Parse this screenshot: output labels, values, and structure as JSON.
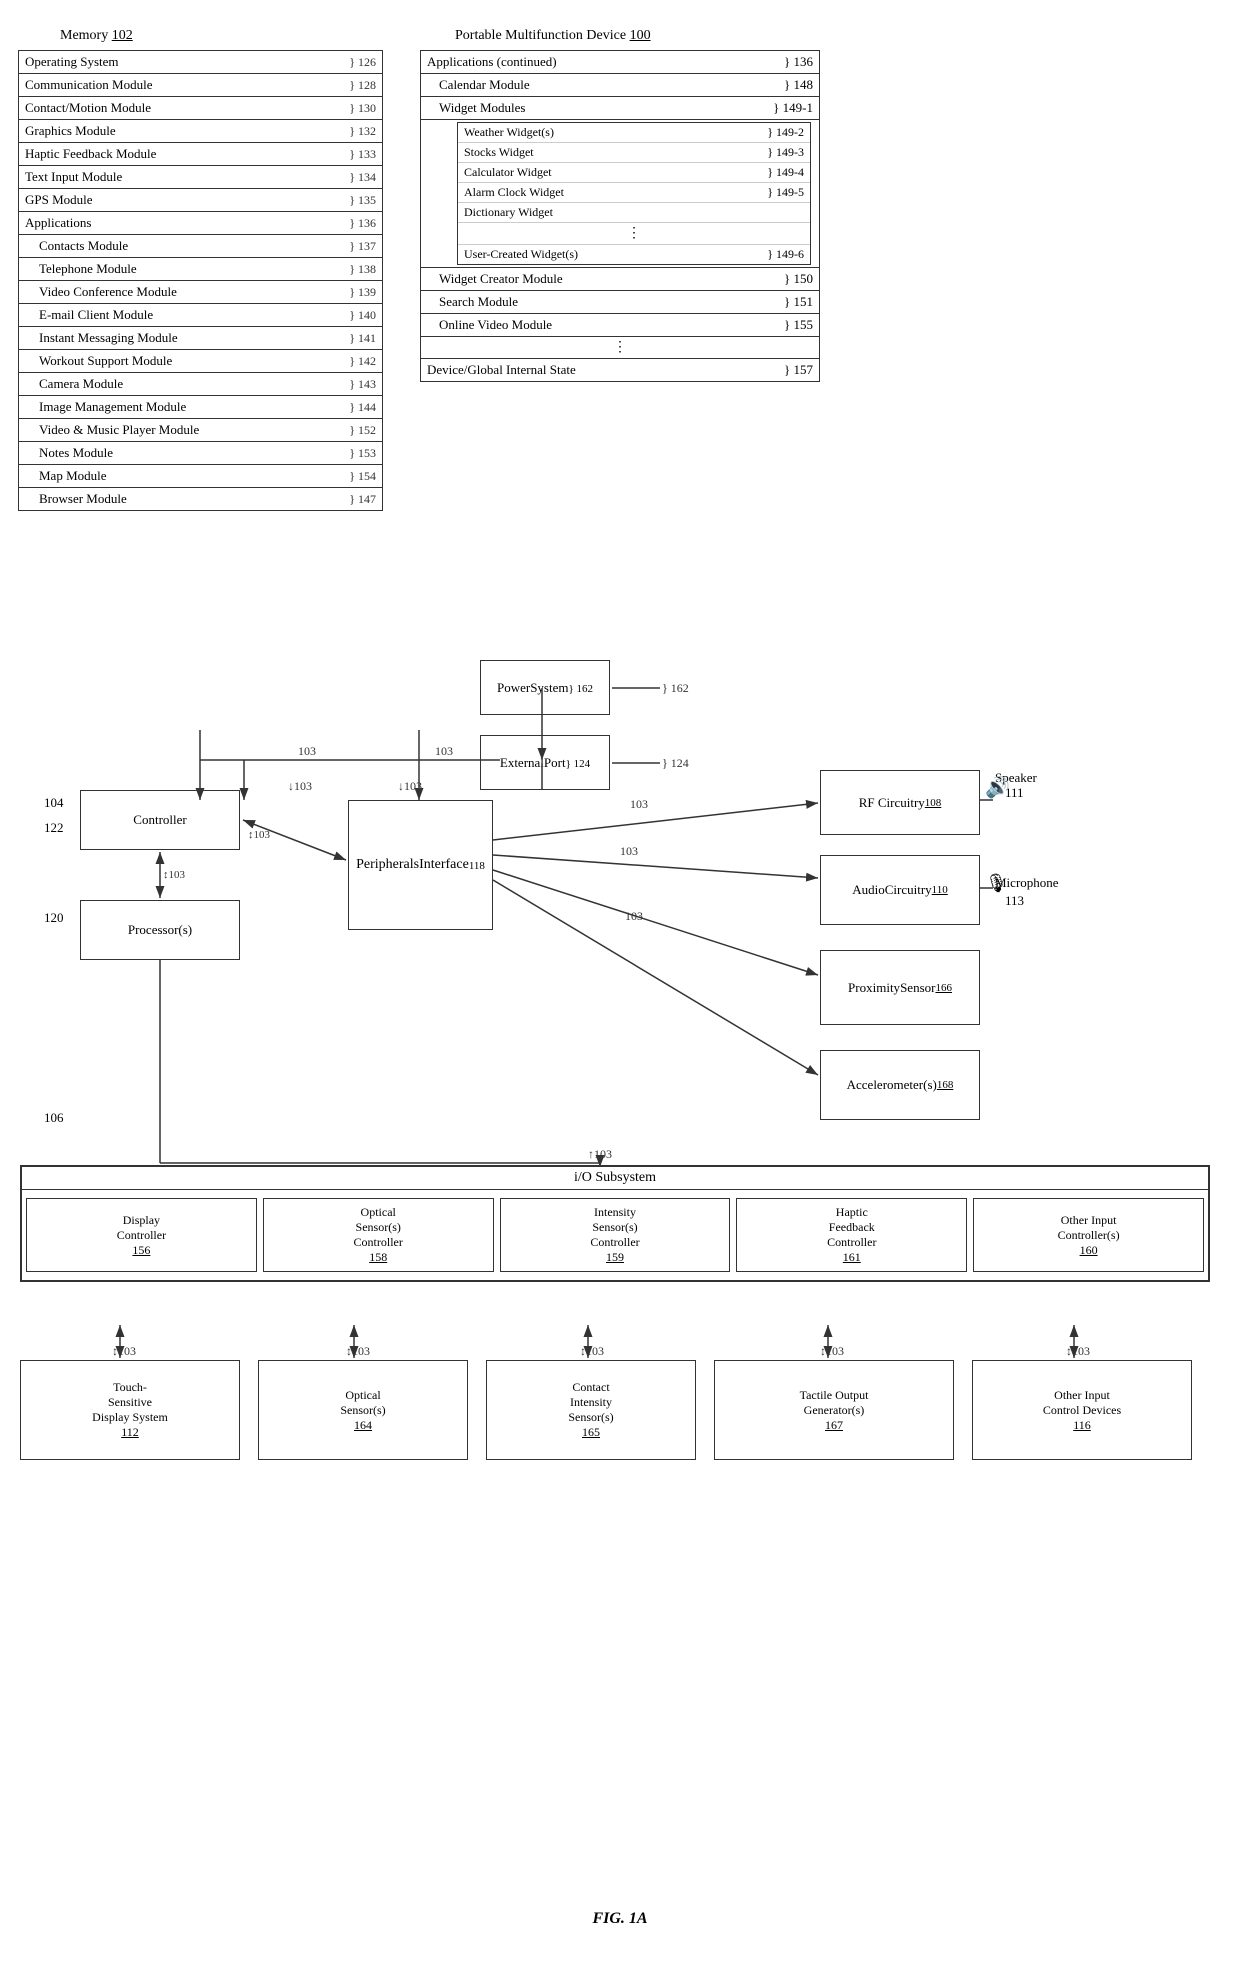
{
  "title": "FIG. 1A",
  "memory": {
    "label": "Memory",
    "ref": "102",
    "rows": [
      {
        "label": "Operating System",
        "ref": "126"
      },
      {
        "label": "Communication Module",
        "ref": "128"
      },
      {
        "label": "Contact/Motion Module",
        "ref": "130"
      },
      {
        "label": "Graphics Module",
        "ref": "132"
      },
      {
        "label": "Haptic Feedback Module",
        "ref": "133"
      },
      {
        "label": "Text Input Module",
        "ref": "134"
      },
      {
        "label": "GPS Module",
        "ref": "135"
      },
      {
        "label": "Applications",
        "ref": "136",
        "header": true
      },
      {
        "label": "Contacts Module",
        "ref": "137",
        "indent": true
      },
      {
        "label": "Telephone Module",
        "ref": "138",
        "indent": true
      },
      {
        "label": "Video Conference Module",
        "ref": "139",
        "indent": true
      },
      {
        "label": "E-mail Client Module",
        "ref": "140",
        "indent": true
      },
      {
        "label": "Instant Messaging Module",
        "ref": "141",
        "indent": true
      },
      {
        "label": "Workout Support Module",
        "ref": "142",
        "indent": true
      },
      {
        "label": "Camera Module",
        "ref": "143",
        "indent": true
      },
      {
        "label": "Image Management Module",
        "ref": "144",
        "indent": true
      },
      {
        "label": "Video & Music Player Module",
        "ref": "152",
        "indent": true
      },
      {
        "label": "Notes Module",
        "ref": "153",
        "indent": true
      },
      {
        "label": "Map Module",
        "ref": "154",
        "indent": true
      },
      {
        "label": "Browser Module",
        "ref": "147",
        "indent": true
      }
    ]
  },
  "pmd": {
    "label": "Portable Multifunction Device",
    "ref": "100",
    "rows": [
      {
        "label": "Applications (continued)",
        "ref": "136"
      },
      {
        "label": "Calendar Module",
        "ref": "148",
        "indent": true
      },
      {
        "label": "Widget Modules",
        "ref": "149-1",
        "indent": true,
        "subheader": true
      },
      {
        "label": "Weather Widget(s)",
        "ref": "149-2",
        "widget": true
      },
      {
        "label": "Stocks Widget",
        "ref": "149-3",
        "widget": true
      },
      {
        "label": "Calculator Widget",
        "ref": "149-4",
        "widget": true
      },
      {
        "label": "Alarm Clock Widget",
        "ref": "149-5",
        "widget": true
      },
      {
        "label": "Dictionary Widget",
        "ref": "",
        "widget": true
      },
      {
        "label": "...",
        "ref": "",
        "widget": true,
        "dots": true
      },
      {
        "label": "User-Created Widget(s)",
        "ref": "149-6",
        "widget": true
      },
      {
        "label": "Widget Creator Module",
        "ref": "150",
        "indent": true
      },
      {
        "label": "Search Module",
        "ref": "151",
        "indent": true
      },
      {
        "label": "Online Video Module",
        "ref": "155",
        "indent": true
      },
      {
        "label": "...",
        "dots": true
      },
      {
        "label": "Device/Global Internal State",
        "ref": "157"
      }
    ]
  },
  "components": {
    "peripherals": {
      "label": "Peripherals\nInterface",
      "ref": "118"
    },
    "controller": {
      "label": "Controller",
      "ref": "104"
    },
    "processor": {
      "label": "Processor(s)",
      "ref": "120"
    },
    "rf": {
      "label": "RF Circuitry\n108",
      "ref": "108"
    },
    "audio": {
      "label": "Audio\nCircuitry\n110",
      "ref": "110"
    },
    "proximity": {
      "label": "Proximity\nSensor",
      "ref": "166"
    },
    "accelerometer": {
      "label": "Accelerometer(s)\n168",
      "ref": "168"
    },
    "power": {
      "label": "Power\nSystem",
      "ref": "162"
    },
    "external_port": {
      "label": "External\nPort",
      "ref": "124"
    },
    "speaker": {
      "label": "Speaker\n111",
      "ref": "111"
    },
    "microphone": {
      "label": "Microphone\n113",
      "ref": "113"
    },
    "bus": "103",
    "io_subsystem": "i/O Subsystem",
    "io_items": [
      {
        "label": "Display\nController",
        "ref": "156"
      },
      {
        "label": "Optical\nSensor(s)\nController",
        "ref": "158"
      },
      {
        "label": "Intensity\nSensor(s)\nController",
        "ref": "159"
      },
      {
        "label": "Haptic\nFeedback\nController",
        "ref": "161"
      },
      {
        "label": "Other Input\nController(s)",
        "ref": "160"
      }
    ],
    "bottom_items": [
      {
        "label": "Touch-\nSensitive\nDisplay System",
        "ref": "112"
      },
      {
        "label": "Optical\nSensor(s)",
        "ref": "164"
      },
      {
        "label": "Contact\nIntensity\nSensor(s)",
        "ref": "165"
      },
      {
        "label": "Tactile Output\nGenerator(s)",
        "ref": "167"
      },
      {
        "label": "Other Input\nControl Devices",
        "ref": "116"
      }
    ]
  },
  "bus_label": "103",
  "fig_caption": "FIG. 1A"
}
